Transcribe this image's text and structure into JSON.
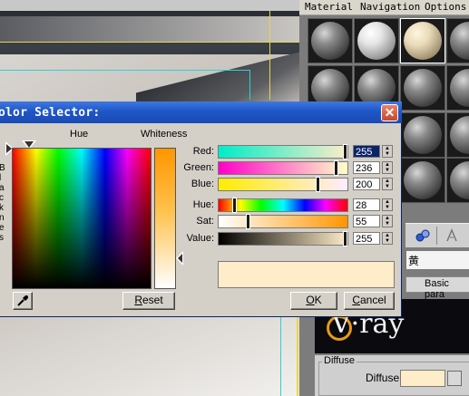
{
  "dialog": {
    "title": "olor Selector:",
    "close_glyph": "✕",
    "hue_label": "Hue",
    "whiteness_label": "Whiteness",
    "side_letters": [
      "B",
      "l",
      "a",
      "c",
      "k",
      "n",
      "e",
      "s"
    ],
    "channels": [
      {
        "label": "Red:",
        "value": "255",
        "level": 1.0,
        "selected": true
      },
      {
        "label": "Green:",
        "value": "236",
        "level": 0.925
      },
      {
        "label": "Blue:",
        "value": "200",
        "level": 0.784
      },
      {
        "label": "Hue:",
        "value": "28",
        "level": 0.11
      },
      {
        "label": "Sat:",
        "value": "55",
        "level": 0.216
      },
      {
        "label": "Value:",
        "value": "255",
        "level": 1.0
      }
    ],
    "preview_color": "#ffecc8",
    "buttons": {
      "reset": {
        "accel": "R",
        "rest": "eset"
      },
      "ok": {
        "accel": "O",
        "rest": "K"
      },
      "cancel": {
        "accel": "C",
        "rest": "ancel"
      }
    },
    "eyedropper_icon": "eyedropper-icon"
  },
  "material_editor": {
    "menu": [
      "Material",
      "Navigation",
      "Options"
    ],
    "name_field": "黄",
    "type_button": "Basic para",
    "logo": "V·ray",
    "diffuse_group": "Diffuse",
    "diffuse_label": "Diffuse",
    "diffuse_color": "#ffecc8"
  },
  "colors": {
    "titlebar": "#1f56c8",
    "dialog_bg": "#d4d0c8",
    "selection": "#0a246a"
  }
}
